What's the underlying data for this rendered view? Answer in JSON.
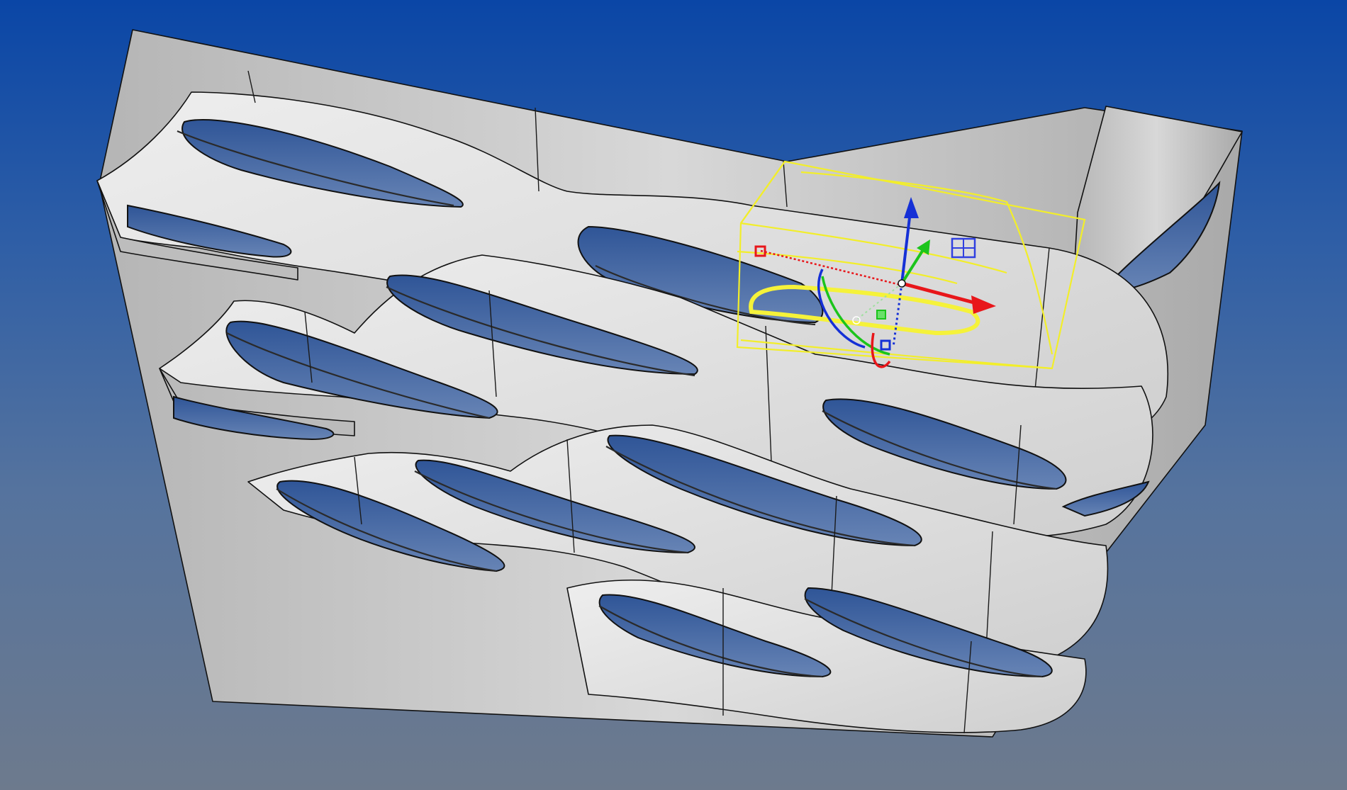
{
  "viewport": {
    "background_top": "#0a46a6",
    "background_bottom": "#6d7a8d",
    "surface_color": "#d6d6d6",
    "opening_color": "#41669e",
    "selection_color": "#f2ee2a"
  },
  "gizmo": {
    "axes": [
      {
        "name": "x",
        "color": "#e8161a"
      },
      {
        "name": "y",
        "color": "#1bc41b"
      },
      {
        "name": "z",
        "color": "#1530d6"
      }
    ],
    "icons": [
      "move-arrow-icon",
      "rotate-arc-icon",
      "scale-handle-icon",
      "plane-grid-icon"
    ]
  }
}
